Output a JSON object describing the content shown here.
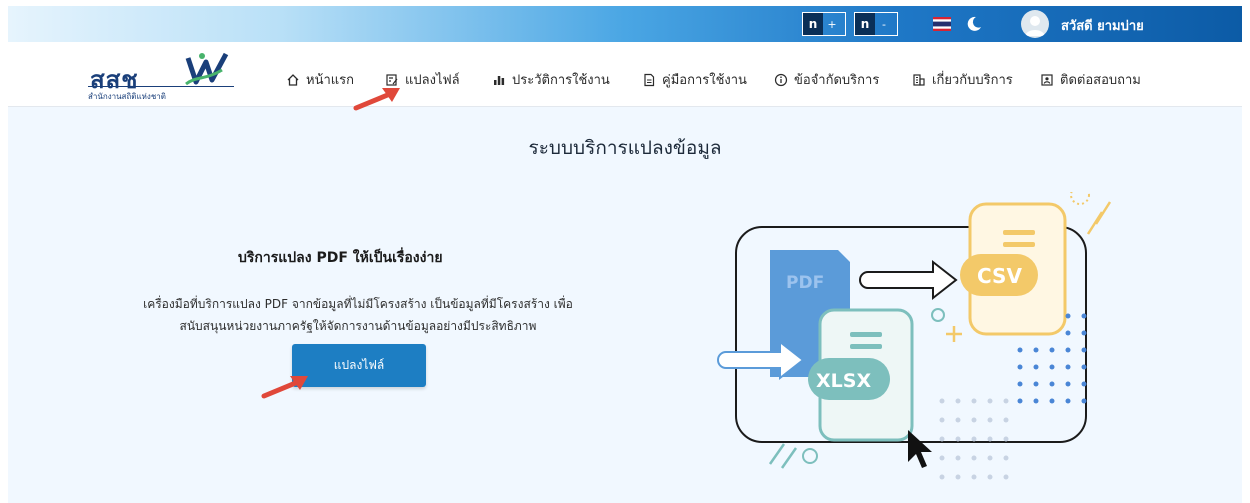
{
  "topbar": {
    "font_controls": [
      {
        "letter": "n",
        "sign": "+"
      },
      {
        "letter": "n",
        "sign": "-"
      }
    ],
    "username": "สวัสดี ยามบ่าย",
    "colors": {
      "gradient_start": "#e6f4fd",
      "gradient_end": "#0c5ba6"
    }
  },
  "logo": {
    "text": "สสช",
    "subtitle": "สำนักงานสถิติแห่งชาติ"
  },
  "nav": {
    "items": [
      {
        "label": "หน้าแรก",
        "icon": "home-icon"
      },
      {
        "label": "แปลงไฟล์",
        "icon": "edit-file-icon"
      },
      {
        "label": "ประวัติการใช้งาน",
        "icon": "bar-chart-icon"
      },
      {
        "label": "คู่มือการใช้งาน",
        "icon": "document-icon"
      },
      {
        "label": "ข้อจำกัดบริการ",
        "icon": "info-icon"
      },
      {
        "label": "เกี่ยวกับบริการ",
        "icon": "building-icon"
      },
      {
        "label": "ติดต่อสอบถาม",
        "icon": "contact-icon"
      }
    ]
  },
  "main": {
    "page_title": "ระบบบริการแปลงข้อมูล",
    "hero_title": "บริการแปลง PDF ให้เป็นเรื่องง่าย",
    "hero_desc_line1": "เครื่องมือที่บริการแปลง PDF จากข้อมูลที่ไม่มีโครงสร้าง เป็นข้อมูลที่มีโครงสร้าง เพื่อ",
    "hero_desc_line2": "สนับสนุนหน่วยงานภาครัฐให้จัดการงานด้านข้อมูลอย่างมีประสิทธิภาพ",
    "cta_label": "แปลงไฟล์",
    "colors": {
      "background": "#f1f8ff",
      "button": "#1d7ec3",
      "annotation_arrow": "#e0483a"
    }
  },
  "illustration": {
    "labels": {
      "pdf": "PDF",
      "csv": "CSV",
      "xlsx": "XLSX"
    },
    "colors": {
      "pdf": "#5b9bd9",
      "csv": "#f3c969",
      "xlsx": "#7dbfbd"
    }
  }
}
